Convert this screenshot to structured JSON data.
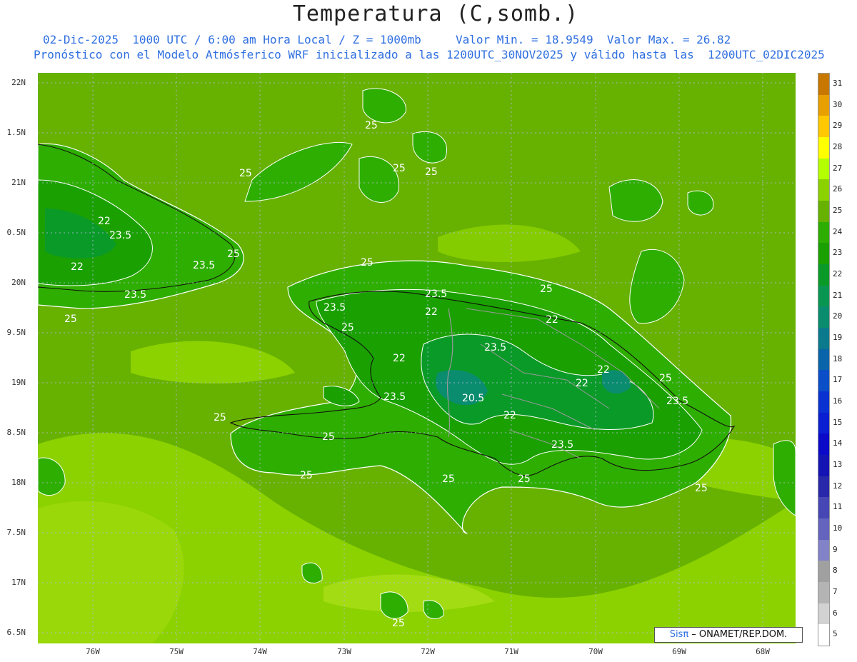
{
  "title": "Temperatura (C,somb.)",
  "subtitle_line1": "02-Dic-2025  1000 UTC / 6:00 am Hora Local / Z = 1000mb     Valor Min. = 18.9549  Valor Max. = 26.82",
  "subtitle_line2": "Pronóstico con el Modelo Atmósferico WRF inicializado a las 1200UTC_30NOV2025 y válido hasta las  1200UTC_02DIC2025",
  "lat_labels": [
    "22N",
    "1.5N",
    "21N",
    "0.5N",
    "20N",
    "9.5N",
    "19N",
    "8.5N",
    "18N",
    "7.5N",
    "17N",
    "6.5N"
  ],
  "lon_labels": [
    "76W",
    "75W",
    "74W",
    "73W",
    "72W",
    "71W",
    "70W",
    "69W",
    "68W"
  ],
  "colorbar": {
    "labels": [
      "31",
      "30",
      "29",
      "28",
      "27",
      "26",
      "25",
      "24",
      "23",
      "22",
      "21",
      "20",
      "19",
      "18",
      "17",
      "16",
      "15",
      "14",
      "13",
      "12",
      "11",
      "10",
      "9",
      "8",
      "7",
      "6",
      "5"
    ],
    "colors": [
      "#c87800",
      "#e8a000",
      "#ffc800",
      "#ffff00",
      "#b4ff00",
      "#8cd200",
      "#67b100",
      "#2eae00",
      "#1aa000",
      "#0a9a28",
      "#099650",
      "#0a8c6e",
      "#0a7a8c",
      "#0a64aa",
      "#0a4ec8",
      "#0a32d2",
      "#0a1ed2",
      "#0a0ac8",
      "#1414b4",
      "#2828aa",
      "#4646b4",
      "#6464be",
      "#8282c8",
      "#a0a0a0",
      "#b4b4b4",
      "#d2d2d2",
      "#ffffff"
    ]
  },
  "contour_labels": [
    "25",
    "25",
    "25",
    "25",
    "22",
    "23.5",
    "22",
    "23.5",
    "25",
    "23.5",
    "25",
    "25",
    "23.5",
    "23.5",
    "22",
    "25",
    "25",
    "22",
    "23.5",
    "22",
    "22",
    "25",
    "22",
    "23.5",
    "20.5",
    "22",
    "23.5",
    "23.5",
    "25",
    "25",
    "25",
    "25",
    "25",
    "25",
    "25"
  ],
  "credit": {
    "brand": "Sisπ",
    "text": " – ONAMET/REP.DOM."
  },
  "colors": {
    "background_field": "#67b100",
    "light_field": "#8cd200",
    "land_field": "#2eae00",
    "dark_field": "#1aa000",
    "subtitle": "#2f6fe0"
  }
}
